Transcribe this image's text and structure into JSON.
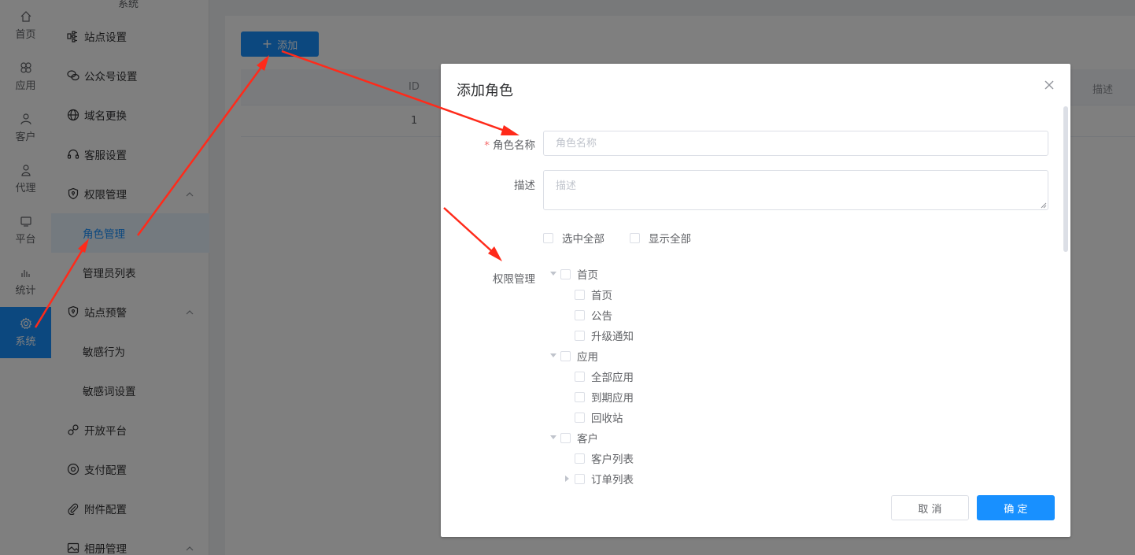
{
  "rail": {
    "items": [
      {
        "label": "首页",
        "icon": "home-icon"
      },
      {
        "label": "应用",
        "icon": "apps-icon"
      },
      {
        "label": "客户",
        "icon": "user-icon"
      },
      {
        "label": "代理",
        "icon": "agent-icon"
      },
      {
        "label": "平台",
        "icon": "platform-icon"
      },
      {
        "label": "统计",
        "icon": "stats-icon"
      },
      {
        "label": "系统",
        "icon": "gear-icon",
        "active": true
      }
    ]
  },
  "sidebar": {
    "top_label": "系统",
    "items": [
      {
        "label": "站点设置",
        "icon": "site-settings-icon"
      },
      {
        "label": "公众号设置",
        "icon": "wechat-icon"
      },
      {
        "label": "域名更换",
        "icon": "globe-icon"
      },
      {
        "label": "客服设置",
        "icon": "headset-icon"
      },
      {
        "label": "权限管理",
        "icon": "shield-icon",
        "expanded": true
      },
      {
        "label": "角色管理",
        "sub": true,
        "active": true
      },
      {
        "label": "管理员列表",
        "sub": true
      },
      {
        "label": "站点预警",
        "icon": "shield-icon",
        "expanded": true
      },
      {
        "label": "敏感行为",
        "sub": true
      },
      {
        "label": "敏感词设置",
        "sub": true
      },
      {
        "label": "开放平台",
        "icon": "open-platform-icon"
      },
      {
        "label": "支付配置",
        "icon": "payment-icon"
      },
      {
        "label": "附件配置",
        "icon": "paperclip-icon"
      },
      {
        "label": "相册管理",
        "icon": "album-icon",
        "expanded": true
      }
    ]
  },
  "main": {
    "add_button": "添加",
    "table": {
      "headers": {
        "id": "ID",
        "desc": "描述"
      },
      "rows": [
        {
          "id": "1"
        }
      ]
    }
  },
  "dialog": {
    "title": "添加角色",
    "fields": {
      "role_name_label": "角色名称",
      "role_name_placeholder": "角色名称",
      "desc_label": "描述",
      "desc_placeholder": "描述",
      "perm_label": "权限管理"
    },
    "options": {
      "select_all": "选中全部",
      "show_all": "显示全部"
    },
    "tree": [
      {
        "label": "首页",
        "level": 0,
        "expanded": true
      },
      {
        "label": "首页",
        "level": 1
      },
      {
        "label": "公告",
        "level": 1
      },
      {
        "label": "升级通知",
        "level": 1
      },
      {
        "label": "应用",
        "level": 0,
        "expanded": true
      },
      {
        "label": "全部应用",
        "level": 1
      },
      {
        "label": "到期应用",
        "level": 1
      },
      {
        "label": "回收站",
        "level": 1
      },
      {
        "label": "客户",
        "level": 0,
        "expanded": true
      },
      {
        "label": "客户列表",
        "level": 1
      },
      {
        "label": "订单列表",
        "level": 1,
        "has_children": true,
        "expanded": false
      }
    ],
    "cancel": "取 消",
    "confirm": "确 定"
  },
  "colors": {
    "primary": "#1890ff",
    "danger": "#f56c6c",
    "annotation_arrow": "#ff2a1a"
  }
}
